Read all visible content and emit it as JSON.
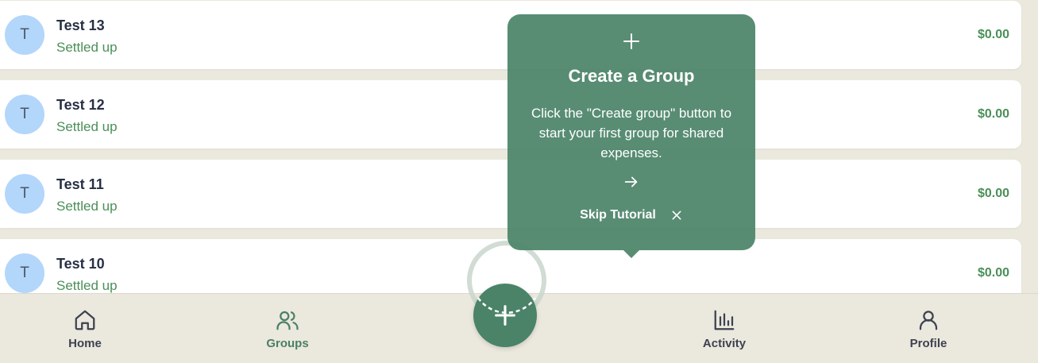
{
  "groups": [
    {
      "initial": "T",
      "name": "Test 13",
      "status": "Settled up",
      "amount": "$0.00"
    },
    {
      "initial": "T",
      "name": "Test 12",
      "status": "Settled up",
      "amount": "$0.00"
    },
    {
      "initial": "T",
      "name": "Test 11",
      "status": "Settled up",
      "amount": "$0.00"
    },
    {
      "initial": "T",
      "name": "Test 10",
      "status": "Settled up",
      "amount": "$0.00"
    }
  ],
  "tooltip": {
    "title": "Create a Group",
    "body": "Click the \"Create group\" button to start your first group for shared expenses.",
    "skip_label": "Skip Tutorial",
    "icons": [
      "plus-icon",
      "arrow-right-icon",
      "close-icon"
    ]
  },
  "nav": {
    "home": "Home",
    "groups": "Groups",
    "activity": "Activity",
    "profile": "Profile",
    "active": "groups",
    "icons": [
      "home-icon",
      "users-icon",
      "plus-icon",
      "bar-chart-icon",
      "user-icon"
    ]
  },
  "colors": {
    "accent": "#4a8368",
    "status_green": "#4a8f57",
    "avatar_bg": "#b3d6fb",
    "background": "#ebe8dd"
  }
}
